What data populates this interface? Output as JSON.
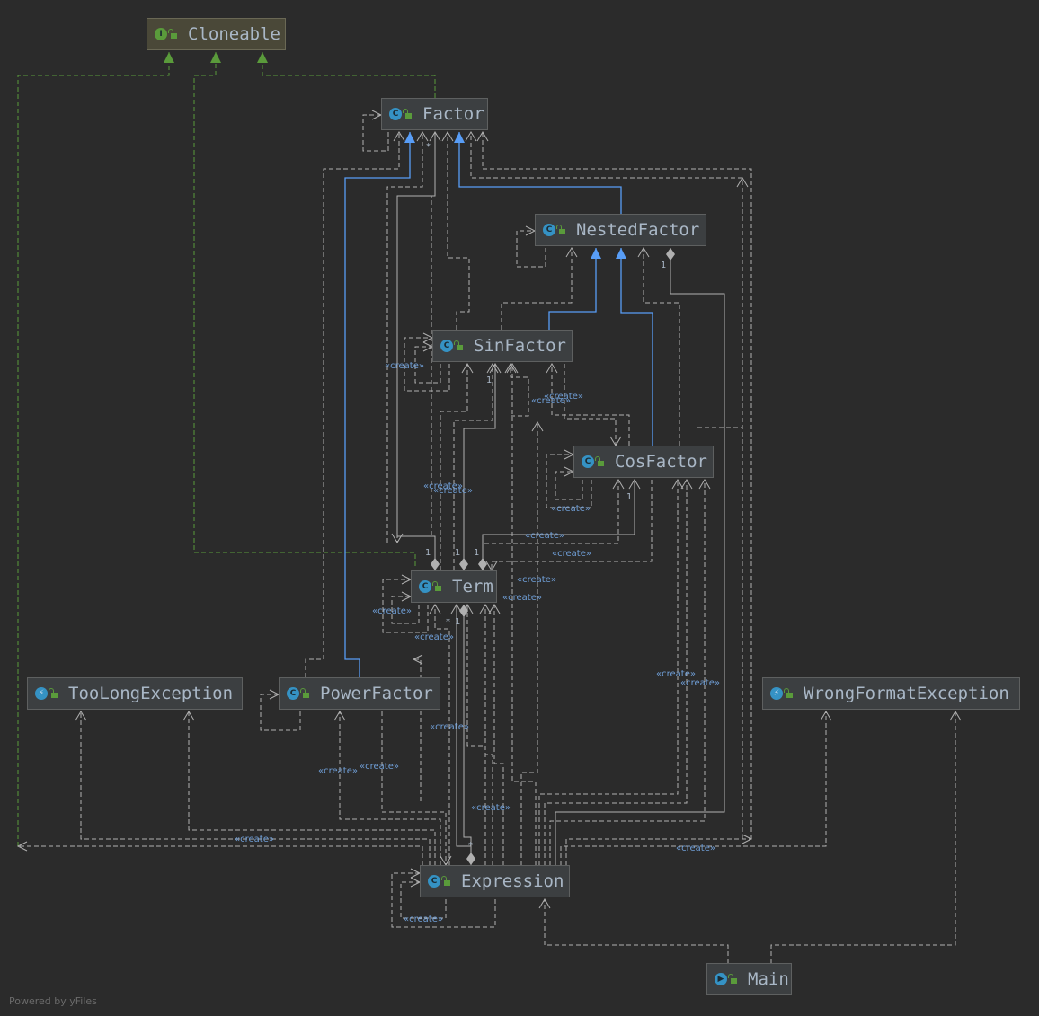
{
  "nodes": {
    "cloneable": {
      "name": "Cloneable",
      "kind": "interface",
      "icon": "interface-icon"
    },
    "factor": {
      "name": "Factor",
      "kind": "abstract-class",
      "icon": "abstract-class-icon"
    },
    "nested_factor": {
      "name": "NestedFactor",
      "kind": "abstract-class",
      "icon": "abstract-class-icon"
    },
    "sin_factor": {
      "name": "SinFactor",
      "kind": "class",
      "icon": "class-icon"
    },
    "cos_factor": {
      "name": "CosFactor",
      "kind": "class",
      "icon": "class-icon"
    },
    "term": {
      "name": "Term",
      "kind": "class",
      "icon": "class-icon"
    },
    "too_long_exception": {
      "name": "TooLongException",
      "kind": "exception",
      "icon": "exception-icon"
    },
    "power_factor": {
      "name": "PowerFactor",
      "kind": "class",
      "icon": "class-icon"
    },
    "wrong_format_exception": {
      "name": "WrongFormatException",
      "kind": "exception",
      "icon": "exception-icon"
    },
    "expression": {
      "name": "Expression",
      "kind": "class",
      "icon": "class-icon"
    },
    "main": {
      "name": "Main",
      "kind": "runnable-class",
      "icon": "main-class-icon"
    }
  },
  "edge_labels": {
    "create": "«create»",
    "one": "1",
    "many": "*"
  },
  "colors": {
    "background": "#2b2b2b",
    "realization": "#5a9b3b",
    "inheritance": "#589df6",
    "dependency": "#b0b0b0",
    "label": "#6f9ed6"
  },
  "footer": "Powered by yFiles"
}
